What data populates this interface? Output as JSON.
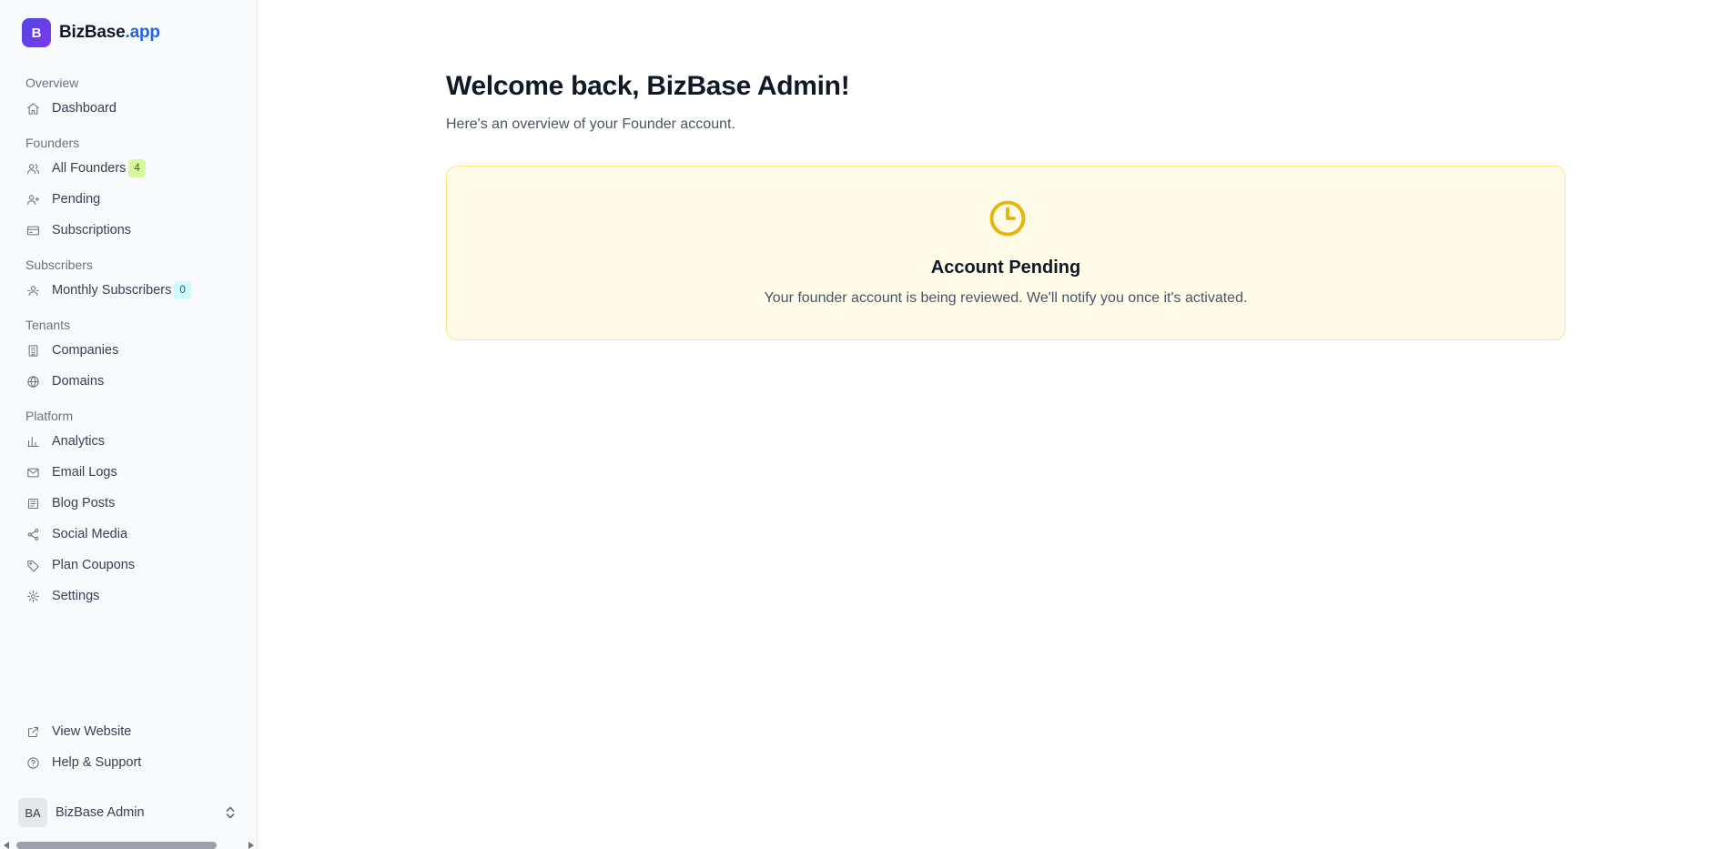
{
  "brand": {
    "logo_letter": "B",
    "name": "BizBase",
    "tld": ".app"
  },
  "sidebar": {
    "sections": [
      {
        "label": "Overview",
        "items": [
          {
            "label": "Dashboard",
            "icon": "home-icon"
          }
        ]
      },
      {
        "label": "Founders",
        "items": [
          {
            "label": "All Founders",
            "icon": "users-icon",
            "badge": "4"
          },
          {
            "label": "Pending",
            "icon": "user-plus-icon"
          },
          {
            "label": "Subscriptions",
            "icon": "credit-card-icon"
          }
        ]
      },
      {
        "label": "Subscribers",
        "items": [
          {
            "label": "Monthly Subscribers",
            "icon": "subscribers-icon",
            "badge": "0"
          }
        ]
      },
      {
        "label": "Tenants",
        "items": [
          {
            "label": "Companies",
            "icon": "building-icon"
          },
          {
            "label": "Domains",
            "icon": "globe-icon"
          }
        ]
      },
      {
        "label": "Platform",
        "items": [
          {
            "label": "Analytics",
            "icon": "bar-chart-icon"
          },
          {
            "label": "Email Logs",
            "icon": "mail-icon"
          },
          {
            "label": "Blog Posts",
            "icon": "newspaper-icon"
          },
          {
            "label": "Social Media",
            "icon": "share-icon"
          },
          {
            "label": "Plan Coupons",
            "icon": "tag-icon"
          },
          {
            "label": "Settings",
            "icon": "gear-icon"
          }
        ]
      }
    ],
    "bottom_items": [
      {
        "label": "View Website",
        "icon": "external-link-icon"
      },
      {
        "label": "Help & Support",
        "icon": "help-circle-icon"
      }
    ],
    "user": {
      "initials": "BA",
      "name": "BizBase Admin"
    }
  },
  "main": {
    "title": "Welcome back, BizBase Admin!",
    "subtitle": "Here's an overview of your Founder account.",
    "card": {
      "icon": "clock-icon",
      "title": "Account Pending",
      "text": "Your founder account is being reviewed. We'll notify you once it's activated."
    }
  },
  "colors": {
    "brand_accent": "#2563eb",
    "logo_gradient_start": "#4f46e5",
    "logo_gradient_end": "#7c3aed",
    "pending_bg": "#fefce8",
    "pending_border": "#fde68a",
    "pending_icon": "#eab308"
  }
}
